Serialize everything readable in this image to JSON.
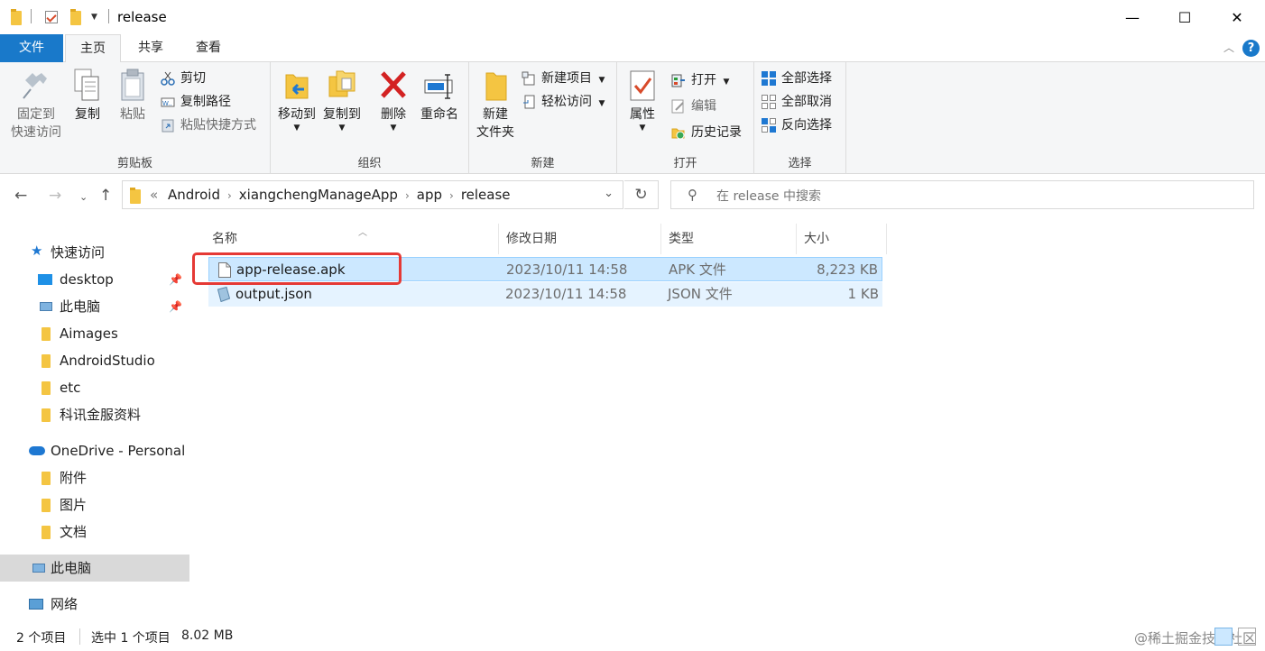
{
  "window": {
    "title": "release"
  },
  "tabs": {
    "file": "文件",
    "home": "主页",
    "share": "共享",
    "view": "查看"
  },
  "ribbon": {
    "clipboard": {
      "label": "剪贴板",
      "pin": [
        "固定到",
        "快速访问"
      ],
      "copy": "复制",
      "paste": "粘贴",
      "cut": "剪切",
      "copy_path": "复制路径",
      "paste_shortcut": "粘贴快捷方式"
    },
    "organize": {
      "label": "组织",
      "move_to": "移动到",
      "copy_to": "复制到",
      "delete": "删除",
      "rename": "重命名"
    },
    "new": {
      "label": "新建",
      "new_folder": [
        "新建",
        "文件夹"
      ],
      "new_item": "新建项目",
      "easy_access": "轻松访问"
    },
    "open": {
      "label": "打开",
      "properties": "属性",
      "open": "打开",
      "edit": "编辑",
      "history": "历史记录"
    },
    "select": {
      "label": "选择",
      "select_all": "全部选择",
      "select_none": "全部取消",
      "invert": "反向选择"
    }
  },
  "address": {
    "overflow": "«",
    "crumbs": [
      "Android",
      "xiangchengManageApp",
      "app",
      "release"
    ],
    "search_placeholder": "在 release 中搜索"
  },
  "sidebar": {
    "quick_access": "快速访问",
    "items": [
      "desktop",
      "此电脑",
      "Aimages",
      "AndroidStudio",
      "etc",
      "科讯金服资料"
    ],
    "onedrive": "OneDrive - Personal",
    "onedrive_items": [
      "附件",
      "图片",
      "文档"
    ],
    "this_pc": "此电脑",
    "network": "网络"
  },
  "columns": {
    "name": "名称",
    "date": "修改日期",
    "type": "类型",
    "size": "大小"
  },
  "files": [
    {
      "name": "app-release.apk",
      "date": "2023/10/11 14:58",
      "type": "APK 文件",
      "size": "8,223 KB"
    },
    {
      "name": "output.json",
      "date": "2023/10/11 14:58",
      "type": "JSON 文件",
      "size": "1 KB"
    }
  ],
  "status": {
    "count": "2 个项目",
    "selected": "选中 1 个项目",
    "selected_size": "8.02 MB",
    "watermark": "@稀土掘金技术社区"
  },
  "colors": {
    "accent": "#1979ca",
    "selection": "#cce8ff",
    "highlight": "#e53935"
  }
}
